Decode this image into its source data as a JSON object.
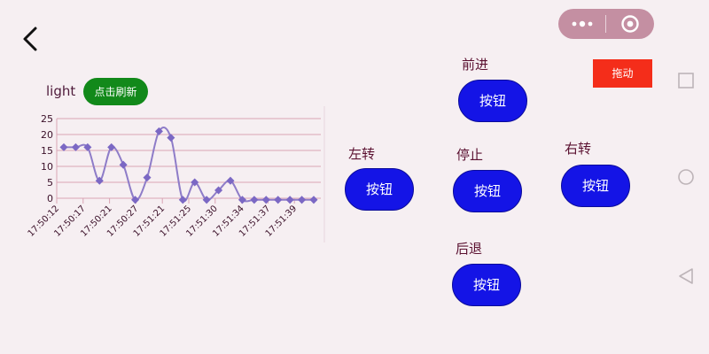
{
  "header": {
    "back_icon": "chevron-left-icon",
    "capsule": {
      "more_icon": "more-dots-icon",
      "close_icon": "target-circle-icon"
    }
  },
  "system_nav": {
    "icons": [
      "square-recent-icon",
      "circle-home-icon",
      "triangle-back-icon"
    ]
  },
  "chart_section": {
    "label": "light",
    "refresh_label": "点击刷新"
  },
  "controls": {
    "drag_label": "拖动",
    "forward": {
      "label": "前进",
      "button": "按钮"
    },
    "left": {
      "label": "左转",
      "button": "按钮"
    },
    "stop": {
      "label": "停止",
      "button": "按钮"
    },
    "right": {
      "label": "右转",
      "button": "按钮"
    },
    "backward": {
      "label": "后退",
      "button": "按钮"
    }
  },
  "colors": {
    "line": "#8e7cc8",
    "marker": "#7b68c4",
    "grid": "#d9a4b4",
    "refresh_button": "#12891a",
    "drag_button": "#f42d1a",
    "control_button": "#1414e6",
    "text": "#5a1030",
    "background": "#f6eff2"
  },
  "chart_data": {
    "type": "line",
    "title": "",
    "xlabel": "",
    "ylabel": "",
    "ylim": [
      0,
      25
    ],
    "yticks": [
      0,
      5,
      10,
      15,
      20,
      25
    ],
    "x_tick_labels": [
      "17:50:12",
      "17:50:17",
      "17:50:21",
      "17:50:27",
      "17:51:21",
      "17:51:25",
      "17:51:30",
      "17:51:34",
      "17:51:37",
      "17:51:39"
    ],
    "grid": true,
    "smooth": true,
    "series": [
      {
        "values": [
          16,
          16,
          16,
          5.5,
          16,
          10.5,
          -0.5,
          6.5,
          21,
          19,
          -0.5,
          5,
          -0.5,
          2.5,
          5.5,
          -0.5,
          -0.5,
          -0.5,
          -0.5,
          -0.5,
          -0.5,
          -0.5
        ]
      }
    ]
  }
}
